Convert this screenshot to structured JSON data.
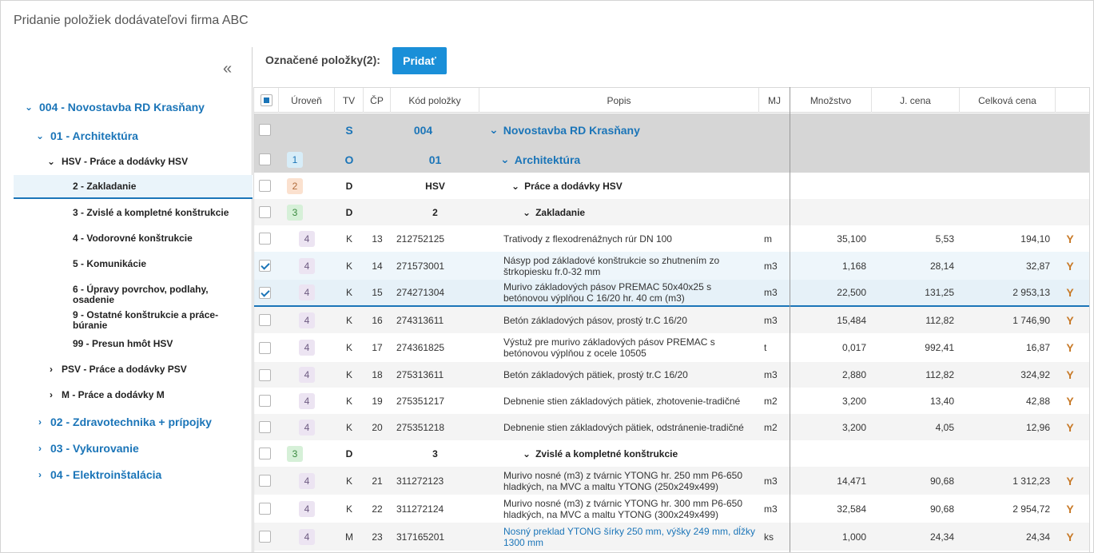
{
  "title": "Pridanie položiek dodávateľovi firma ABC",
  "toolbar": {
    "selected_label": "Označené položky(2):",
    "add_button": "Pridať"
  },
  "sidebar": {
    "collapse_icon": "«",
    "tree": [
      {
        "label": "004 - Novostavba RD Krasňany",
        "chev": "⌄"
      },
      {
        "label": "01 - Architektúra",
        "chev": "⌄"
      },
      {
        "label": "HSV - Práce a dodávky HSV",
        "chev": "⌄"
      },
      {
        "label": "2 - Zakladanie",
        "chev": ""
      },
      {
        "label": "3 - Zvislé a kompletné konštrukcie",
        "chev": ""
      },
      {
        "label": "4 - Vodorovné konštrukcie",
        "chev": ""
      },
      {
        "label": "5 - Komunikácie",
        "chev": ""
      },
      {
        "label": "6 - Úpravy povrchov, podlahy, osadenie",
        "chev": ""
      },
      {
        "label": "9 - Ostatné konštrukcie a práce-búranie",
        "chev": ""
      },
      {
        "label": "99 - Presun hmôt HSV",
        "chev": ""
      },
      {
        "label": "PSV - Práce a dodávky PSV",
        "chev": "›"
      },
      {
        "label": "M - Práce a dodávky M",
        "chev": "›"
      },
      {
        "label": "02 - Zdravotechnika + prípojky",
        "chev": "›"
      },
      {
        "label": "03 - Vykurovanie",
        "chev": "›"
      },
      {
        "label": "04 - Elektroinštalácia",
        "chev": "›"
      }
    ]
  },
  "grid": {
    "headers": [
      "Úroveň",
      "TV",
      "ČP",
      "Kód položky",
      "Popis",
      "MJ",
      "Množstvo",
      "J. cena",
      "Celková cena"
    ],
    "rows": [
      {
        "lvl": "",
        "tv": "S",
        "cp": "",
        "kod": "004",
        "popis": "Novostavba RD Krasňany",
        "mj": "",
        "mn": "",
        "jc": "",
        "cc": "",
        "chev": "⌄"
      },
      {
        "lvl": "1",
        "tv": "O",
        "cp": "",
        "kod": "01",
        "popis": "Architektúra",
        "mj": "",
        "mn": "",
        "jc": "",
        "cc": "",
        "chev": "⌄"
      },
      {
        "lvl": "2",
        "tv": "D",
        "cp": "",
        "kod": "HSV",
        "popis": "Práce a dodávky HSV",
        "mj": "",
        "mn": "",
        "jc": "",
        "cc": "",
        "chev": "⌄"
      },
      {
        "lvl": "3",
        "tv": "D",
        "cp": "",
        "kod": "2",
        "popis": "Zakladanie",
        "mj": "",
        "mn": "",
        "jc": "",
        "cc": "",
        "chev": "⌄"
      },
      {
        "lvl": "4",
        "tv": "K",
        "cp": "13",
        "kod": "212752125",
        "popis": "Trativody z flexodrenážnych rúr DN 100",
        "mj": "m",
        "mn": "35,100",
        "jc": "5,53",
        "cc": "194,10",
        "chev": ""
      },
      {
        "lvl": "4",
        "tv": "K",
        "cp": "14",
        "kod": "271573001",
        "popis": "Násyp pod základové konštrukcie so zhutnením zo štrkopiesku fr.0-32 mm",
        "mj": "m3",
        "mn": "1,168",
        "jc": "28,14",
        "cc": "32,87",
        "chev": ""
      },
      {
        "lvl": "4",
        "tv": "K",
        "cp": "15",
        "kod": "274271304",
        "popis": "Murivo základových pásov PREMAC 50x40x25 s betónovou výplňou C 16/20 hr. 40 cm (m3)",
        "mj": "m3",
        "mn": "22,500",
        "jc": "131,25",
        "cc": "2 953,13",
        "chev": ""
      },
      {
        "lvl": "4",
        "tv": "K",
        "cp": "16",
        "kod": "274313611",
        "popis": "Betón základových pásov, prostý tr.C 16/20",
        "mj": "m3",
        "mn": "15,484",
        "jc": "112,82",
        "cc": "1 746,90",
        "chev": ""
      },
      {
        "lvl": "4",
        "tv": "K",
        "cp": "17",
        "kod": "274361825",
        "popis": "Výstuž pre murivo základových pásov PREMAC s betónovou výplňou z ocele 10505",
        "mj": "t",
        "mn": "0,017",
        "jc": "992,41",
        "cc": "16,87",
        "chev": ""
      },
      {
        "lvl": "4",
        "tv": "K",
        "cp": "18",
        "kod": "275313611",
        "popis": "Betón základových pätiek, prostý tr.C 16/20",
        "mj": "m3",
        "mn": "2,880",
        "jc": "112,82",
        "cc": "324,92",
        "chev": ""
      },
      {
        "lvl": "4",
        "tv": "K",
        "cp": "19",
        "kod": "275351217",
        "popis": "Debnenie stien základových pätiek, zhotovenie-tradičné",
        "mj": "m2",
        "mn": "3,200",
        "jc": "13,40",
        "cc": "42,88",
        "chev": ""
      },
      {
        "lvl": "4",
        "tv": "K",
        "cp": "20",
        "kod": "275351218",
        "popis": "Debnenie stien základových pätiek, odstránenie-tradičné",
        "mj": "m2",
        "mn": "3,200",
        "jc": "4,05",
        "cc": "12,96",
        "chev": ""
      },
      {
        "lvl": "3",
        "tv": "D",
        "cp": "",
        "kod": "3",
        "popis": "Zvislé a kompletné konštrukcie",
        "mj": "",
        "mn": "",
        "jc": "",
        "cc": "",
        "chev": "⌄"
      },
      {
        "lvl": "4",
        "tv": "K",
        "cp": "21",
        "kod": "311272123",
        "popis": "Murivo nosné (m3) z tvárnic YTONG hr. 250 mm P6-650 hladkých, na MVC a maltu YTONG (250x249x499)",
        "mj": "m3",
        "mn": "14,471",
        "jc": "90,68",
        "cc": "1 312,23",
        "chev": ""
      },
      {
        "lvl": "4",
        "tv": "K",
        "cp": "22",
        "kod": "311272124",
        "popis": "Murivo nosné (m3) z tvárnic YTONG hr. 300 mm P6-650 hladkých, na MVC a maltu YTONG (300x249x499)",
        "mj": "m3",
        "mn": "32,584",
        "jc": "90,68",
        "cc": "2 954,72",
        "chev": ""
      },
      {
        "lvl": "4",
        "tv": "M",
        "cp": "23",
        "kod": "317165201",
        "popis": "Nosný preklad YTONG šírky 250 mm, výšky 249 mm, dĺžky 1300 mm",
        "mj": "ks",
        "mn": "1,000",
        "jc": "24,34",
        "cc": "24,34",
        "chev": ""
      }
    ],
    "row_icon": "Y"
  }
}
